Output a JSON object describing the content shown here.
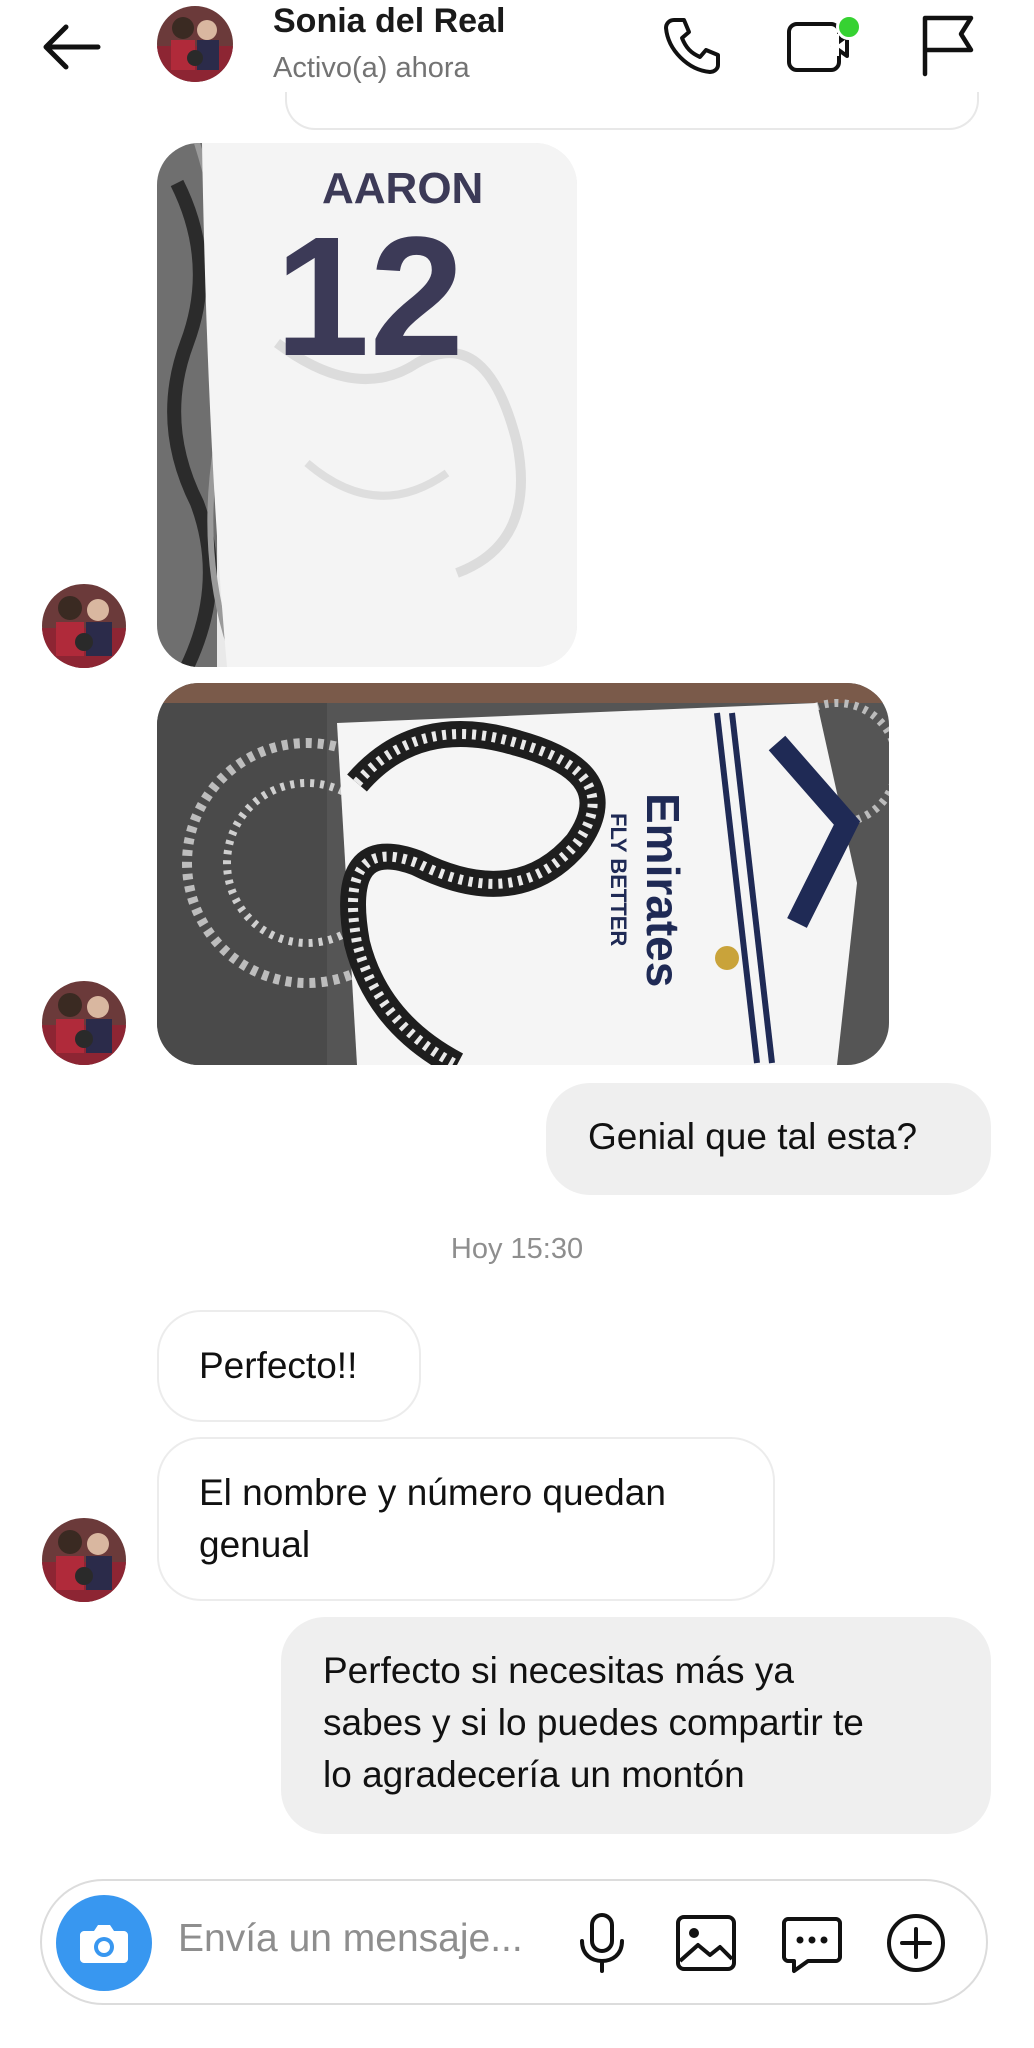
{
  "header": {
    "back_icon": "arrow-left-icon",
    "name": "Sonia del Real",
    "status": "Activo(a) ahora",
    "call_icon": "phone-icon",
    "video_icon": "video-call-icon",
    "flag_icon": "flag-icon",
    "online_color": "#36d232"
  },
  "messages": {
    "photo1": {
      "jersey_name": "AARON",
      "jersey_number": "12"
    },
    "photo2": {
      "sponsor": "Emirates",
      "tagline": "FLY BETTER"
    },
    "out1": "Genial que tal esta?",
    "timestamp": "Hoy 15:30",
    "in1": "Perfecto!!",
    "in2_line1": "El nombre y número quedan",
    "in2_line2": "genual",
    "out2_line1": "Perfecto si necesitas más ya",
    "out2_line2": "sabes y si lo puedes compartir te",
    "out2_line3": "lo agradecería un montón"
  },
  "composer": {
    "placeholder": "Envía un mensaje...",
    "camera_icon": "camera-icon",
    "mic_icon": "microphone-icon",
    "gallery_icon": "image-icon",
    "sticker_icon": "chat-bubble-icon",
    "add_icon": "plus-circle-icon",
    "accent": "#3897f0"
  }
}
